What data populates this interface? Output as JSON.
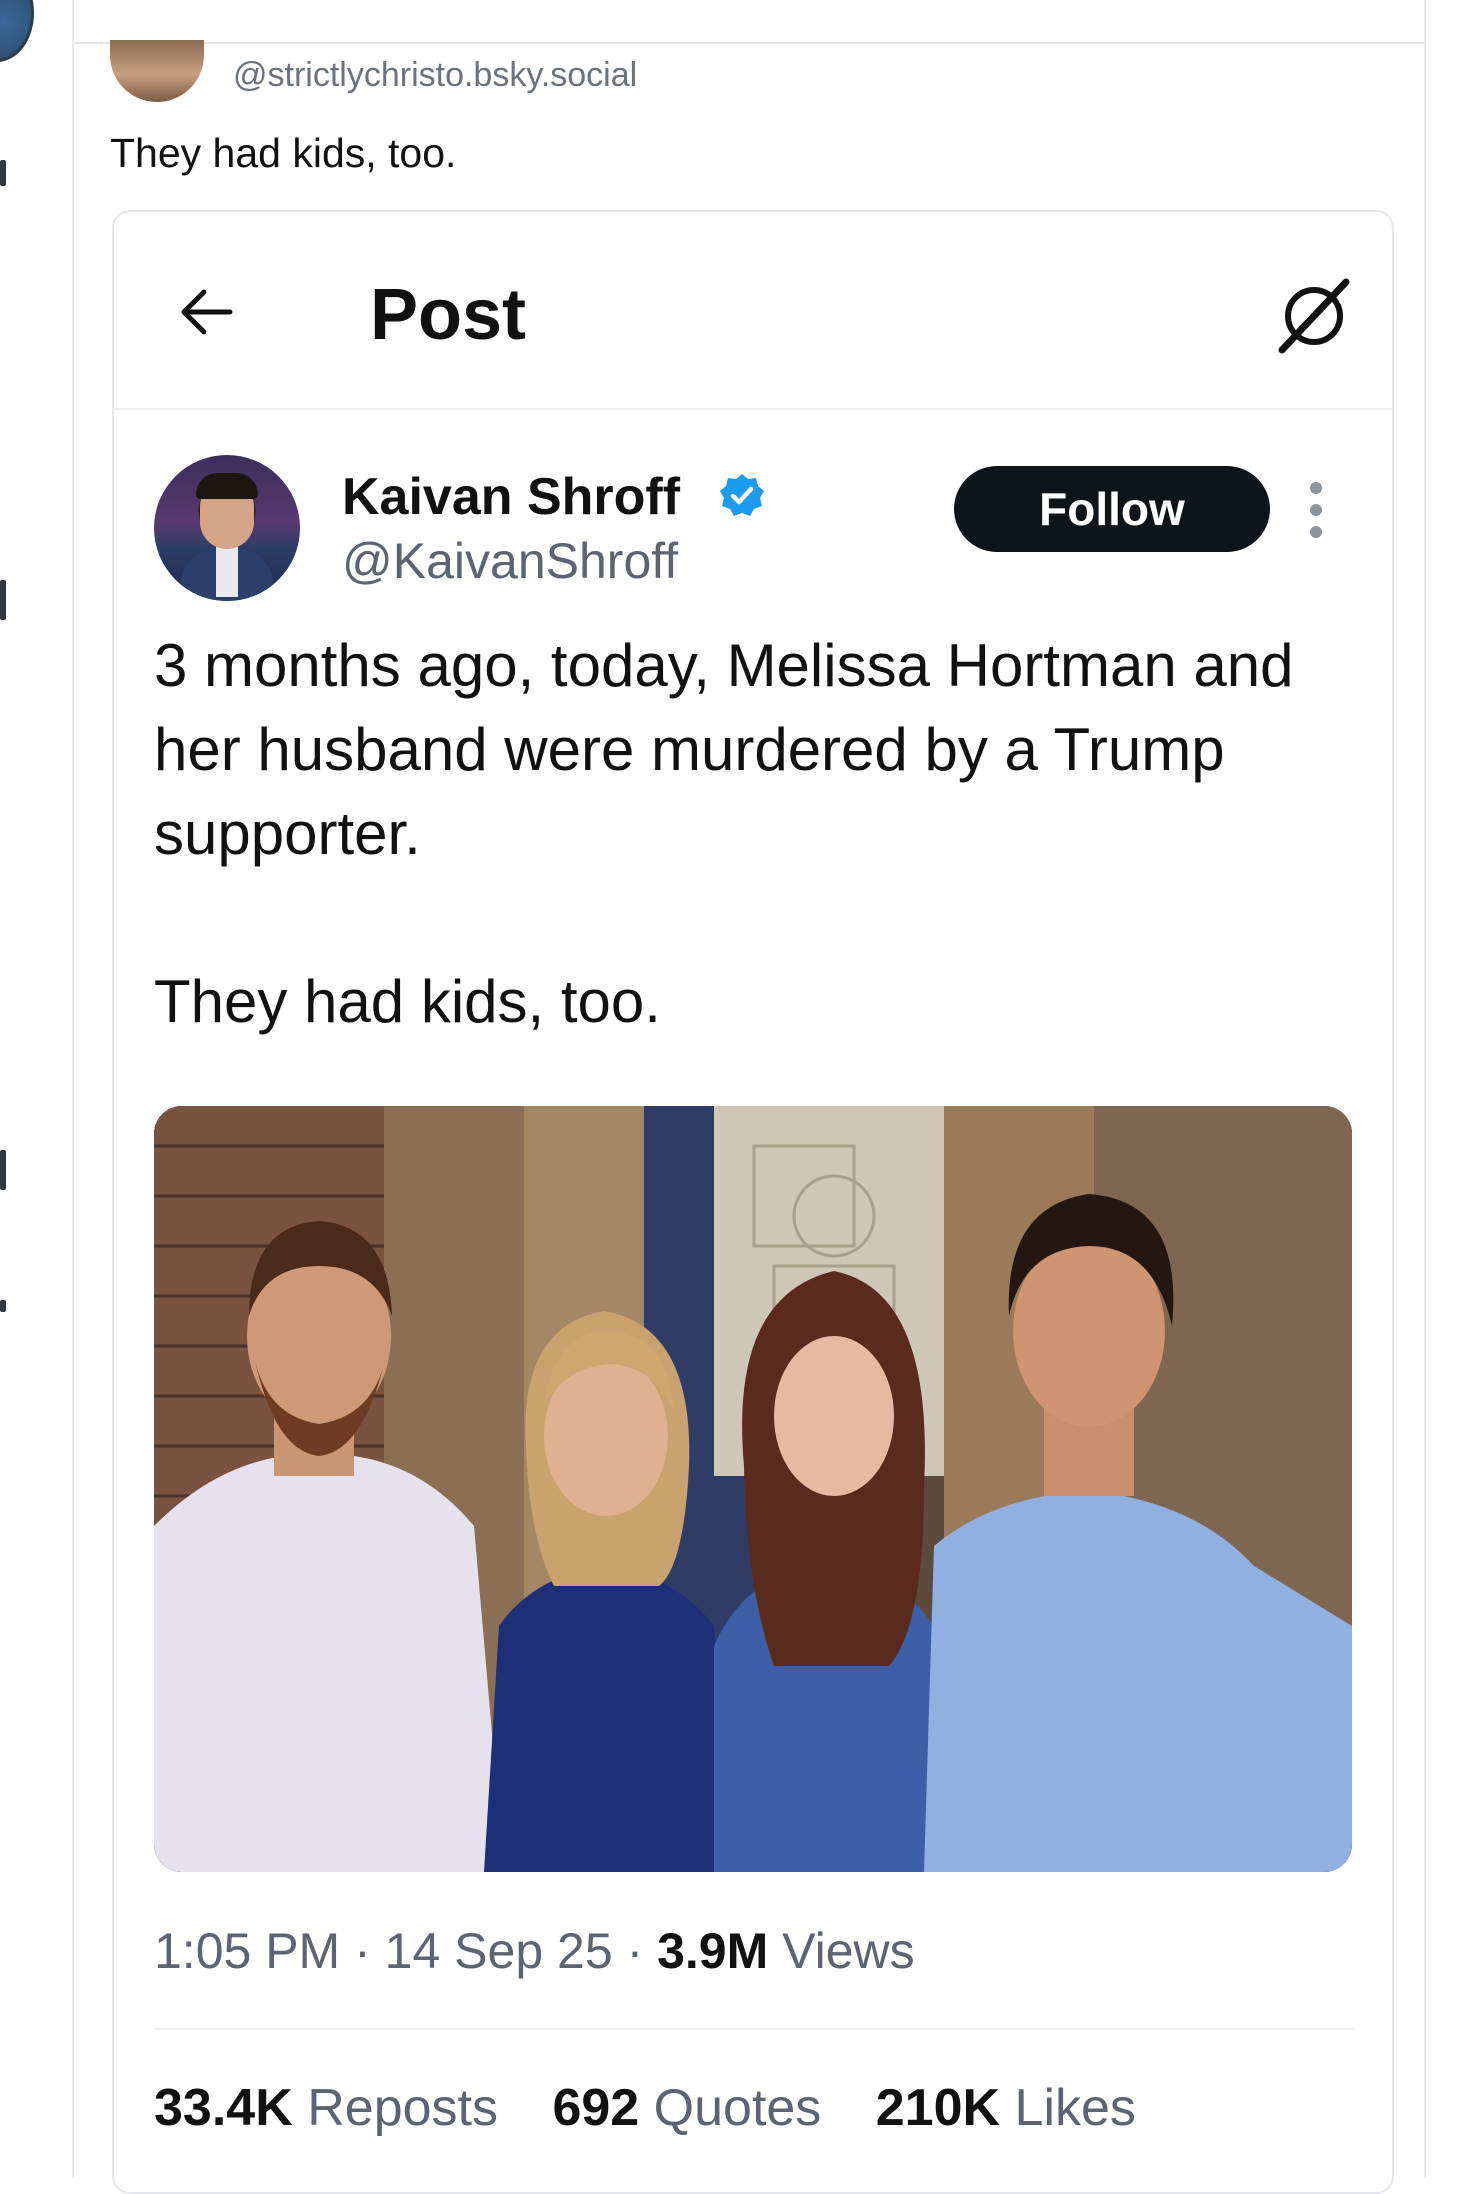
{
  "bluesky_post": {
    "handle": "@strictlychristo.bsky.social",
    "text": "They had kids, too."
  },
  "embedded_x_post": {
    "header_title": "Post",
    "author": {
      "display_name": "Kaivan Shroff",
      "handle": "@KaivanShroff"
    },
    "follow_label": "Follow",
    "body": [
      "3 months ago, today, Melissa Hortman and her husband were murdered by a Trump supporter.",
      "They had kids, too."
    ],
    "meta": {
      "time": "1:05 PM",
      "date": "14 Sep 25",
      "views_count": "3.9M",
      "views_label": "Views"
    },
    "stats": {
      "reposts_count": "33.4K",
      "reposts_label": "Reposts",
      "quotes_count": "692",
      "quotes_label": "Quotes",
      "likes_count": "210K",
      "likes_label": "Likes"
    },
    "icons": {
      "back": "arrow-left-icon",
      "grok": "grok-icon",
      "verified": "verified-badge-icon",
      "more": "more-vertical-icon"
    },
    "colors": {
      "verified": "#1d9bf0",
      "follow_button_bg": "#0f1419",
      "muted_text": "#5b6470"
    }
  }
}
